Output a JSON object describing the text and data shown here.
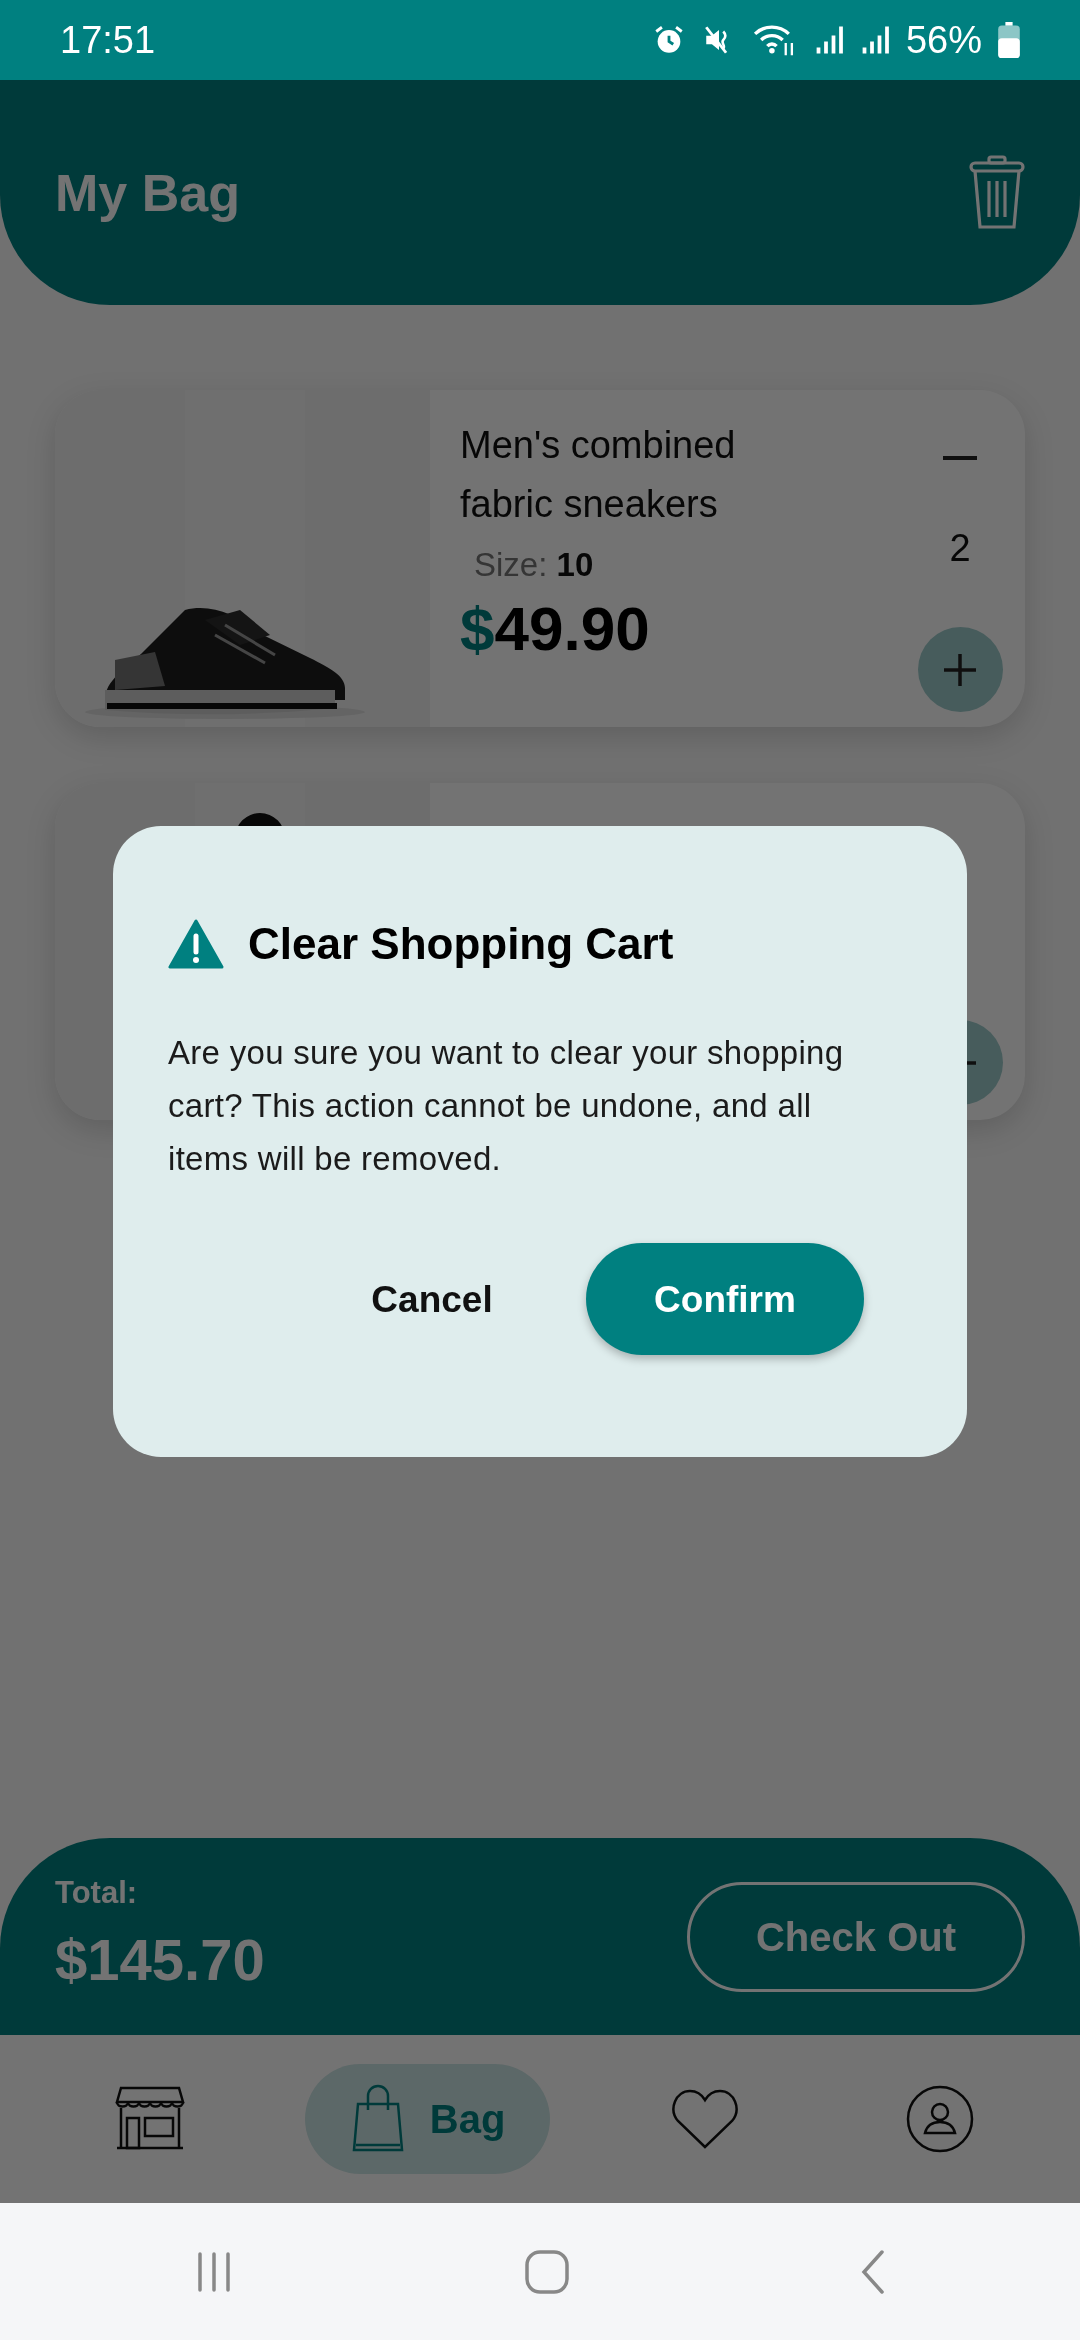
{
  "status_bar": {
    "time": "17:51",
    "battery": "56%"
  },
  "header": {
    "title": "My Bag"
  },
  "cart_items": [
    {
      "kind": "full",
      "name": "Men's combined fabric sneakers",
      "size_label": "Size:",
      "size": "10",
      "currency": "$",
      "price": "49.90",
      "quantity": "2"
    },
    {
      "kind": "covered"
    }
  ],
  "total": {
    "label": "Total:",
    "amount": "$145.70"
  },
  "checkout_button": "Check Out",
  "bottom_nav": [
    {
      "kind": "store",
      "selected": false
    },
    {
      "kind": "bag",
      "label": "Bag",
      "selected": true
    },
    {
      "kind": "heart",
      "selected": false
    },
    {
      "kind": "profile",
      "selected": false
    }
  ],
  "dialog": {
    "title": "Clear Shopping Cart",
    "message": "Are you sure you want to clear your shopping cart? This action cannot be undone, and all items will be removed.",
    "buttons": [
      {
        "kind": "text",
        "label": "Cancel"
      },
      {
        "kind": "filled",
        "label": "Confirm"
      }
    ]
  }
}
